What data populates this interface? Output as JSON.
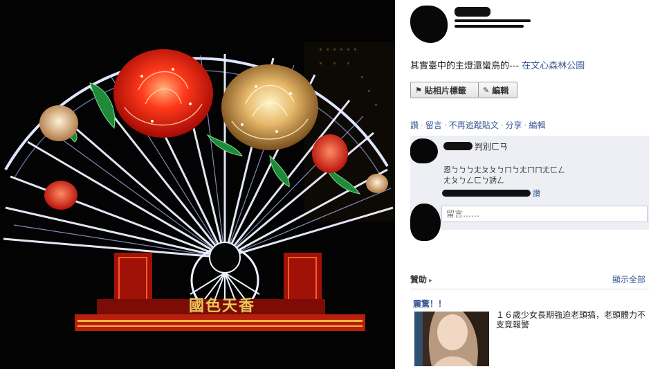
{
  "photo": {
    "caption_text": "國色天香"
  },
  "post": {
    "caption": "其實臺中的主燈還蠻鳥的---",
    "place_link": "在文心森林公園"
  },
  "toolbar": {
    "tag_label": "貼相片標籤",
    "edit_label": "編輯"
  },
  "actions": {
    "like": "讚",
    "comment": "留言",
    "unfollow": "不再追蹤貼文",
    "share": "分享",
    "edit": "編輯"
  },
  "comment": {
    "name_suffix": "判別ㄈㄢ",
    "text": "恩ㄅㄅㄅㄤㄆㄆㄅㄇㄅㄤㄇㄇㄤㄈㄥ\nㄤㄆㄅㄥㄈㄅ誘ㄥ",
    "like": "讚",
    "input_placeholder": "留言……"
  },
  "sponsored": {
    "heading": "贊助",
    "see_all": "顯示全部",
    "ad_title": "震驚！！",
    "ad_text": "１６歲少女長期強迫老頭搞，老頭體力不支竟報警"
  },
  "colors": {
    "link": "#3b5998",
    "comment_bg": "#edeff4",
    "photo_bg": "#000000"
  },
  "icons": {
    "tag": "tag-icon",
    "edit": "pencil-icon",
    "sponsored": "megaphone-icon"
  }
}
